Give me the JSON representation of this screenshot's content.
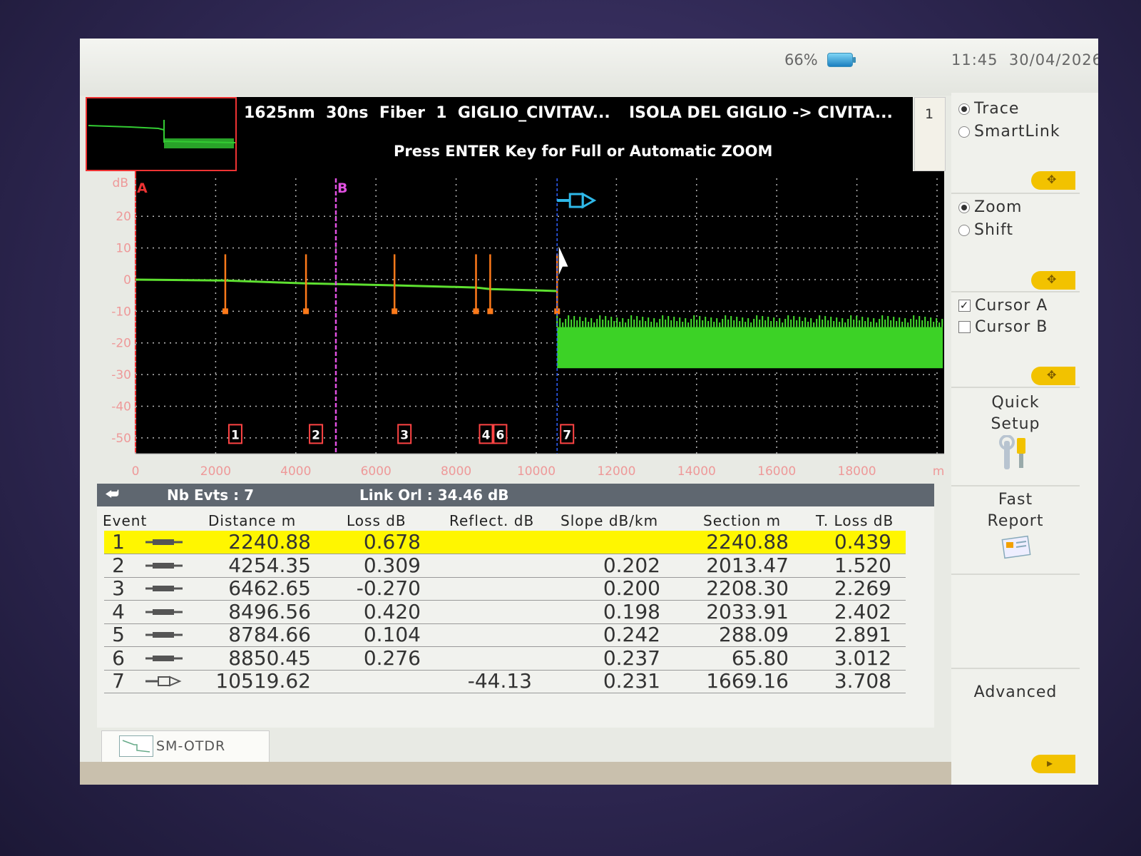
{
  "status": {
    "battery": "66%",
    "time": "11:45",
    "date": "30/04/2026"
  },
  "header": {
    "trace_info": "1625nm  30ns  Fiber  1  GIGLIO_CIVITAV...",
    "route": "ISOLA DEL GIGLIO -> CIVITA...",
    "hint": "Press ENTER Key for Full or Automatic ZOOM",
    "page_indicator": "1"
  },
  "chart_data": {
    "type": "line",
    "ylabel": "dB",
    "xlabel": "m",
    "x_ticks": [
      0,
      2000,
      4000,
      6000,
      8000,
      10000,
      12000,
      14000,
      16000,
      18000
    ],
    "y_ticks": [
      20,
      10,
      0,
      -10,
      -20,
      -30,
      -40,
      -50
    ],
    "xlim": [
      0,
      20000
    ],
    "ylim": [
      -55,
      32
    ],
    "cursor_a": {
      "label": "A",
      "x": 0
    },
    "cursor_b": {
      "label": "B",
      "x": 5000
    },
    "trace": [
      [
        0,
        0
      ],
      [
        2240,
        -0.3
      ],
      [
        4254,
        -1.2
      ],
      [
        6462,
        -1.8
      ],
      [
        8496,
        -2.5
      ],
      [
        8850,
        -3.0
      ],
      [
        10519,
        -3.6
      ]
    ],
    "events": [
      {
        "label": "1",
        "x": 2240.88
      },
      {
        "label": "2",
        "x": 4254.35
      },
      {
        "label": "3",
        "x": 6462.65
      },
      {
        "label": "4",
        "x": 8496.56
      },
      {
        "label": "6",
        "x": 8850.45
      },
      {
        "label": "7",
        "x": 10519.62
      }
    ],
    "noise_floor": [
      -28,
      -15
    ]
  },
  "side": {
    "trace": "Trace",
    "smartlink": "SmartLink",
    "zoom": "Zoom",
    "shift": "Shift",
    "cursor_a": "Cursor A",
    "cursor_b": "Cursor B",
    "quick_setup_1": "Quick",
    "quick_setup_2": "Setup",
    "fast_report_1": "Fast",
    "fast_report_2": "Report",
    "advanced": "Advanced"
  },
  "events_bar": {
    "nb_evts": "Nb Evts : 7",
    "link_orl": "Link Orl :  34.46 dB"
  },
  "table": {
    "headers": {
      "event": "Event",
      "distance": "Distance  m",
      "loss": "Loss dB",
      "reflect": "Reflect. dB",
      "slope": "Slope  dB/km",
      "section": "Section m",
      "tloss": "T. Loss dB"
    },
    "rows": [
      {
        "event": "1",
        "distance": "2240.88",
        "loss": "0.678",
        "reflect": "",
        "slope": "",
        "section": "2240.88",
        "tloss": "0.439"
      },
      {
        "event": "2",
        "distance": "4254.35",
        "loss": "0.309",
        "reflect": "",
        "slope": "0.202",
        "section": "2013.47",
        "tloss": "1.520"
      },
      {
        "event": "3",
        "distance": "6462.65",
        "loss": "-0.270",
        "reflect": "",
        "slope": "0.200",
        "section": "2208.30",
        "tloss": "2.269"
      },
      {
        "event": "4",
        "distance": "8496.56",
        "loss": "0.420",
        "reflect": "",
        "slope": "0.198",
        "section": "2033.91",
        "tloss": "2.402"
      },
      {
        "event": "5",
        "distance": "8784.66",
        "loss": "0.104",
        "reflect": "",
        "slope": "0.242",
        "section": "288.09",
        "tloss": "2.891"
      },
      {
        "event": "6",
        "distance": "8850.45",
        "loss": "0.276",
        "reflect": "",
        "slope": "0.237",
        "section": "65.80",
        "tloss": "3.012"
      },
      {
        "event": "7",
        "distance": "10519.62",
        "loss": "",
        "reflect": "-44.13",
        "slope": "0.231",
        "section": "1669.16",
        "tloss": "3.708"
      }
    ]
  },
  "bottom_tab": {
    "label": "SM-OTDR"
  }
}
